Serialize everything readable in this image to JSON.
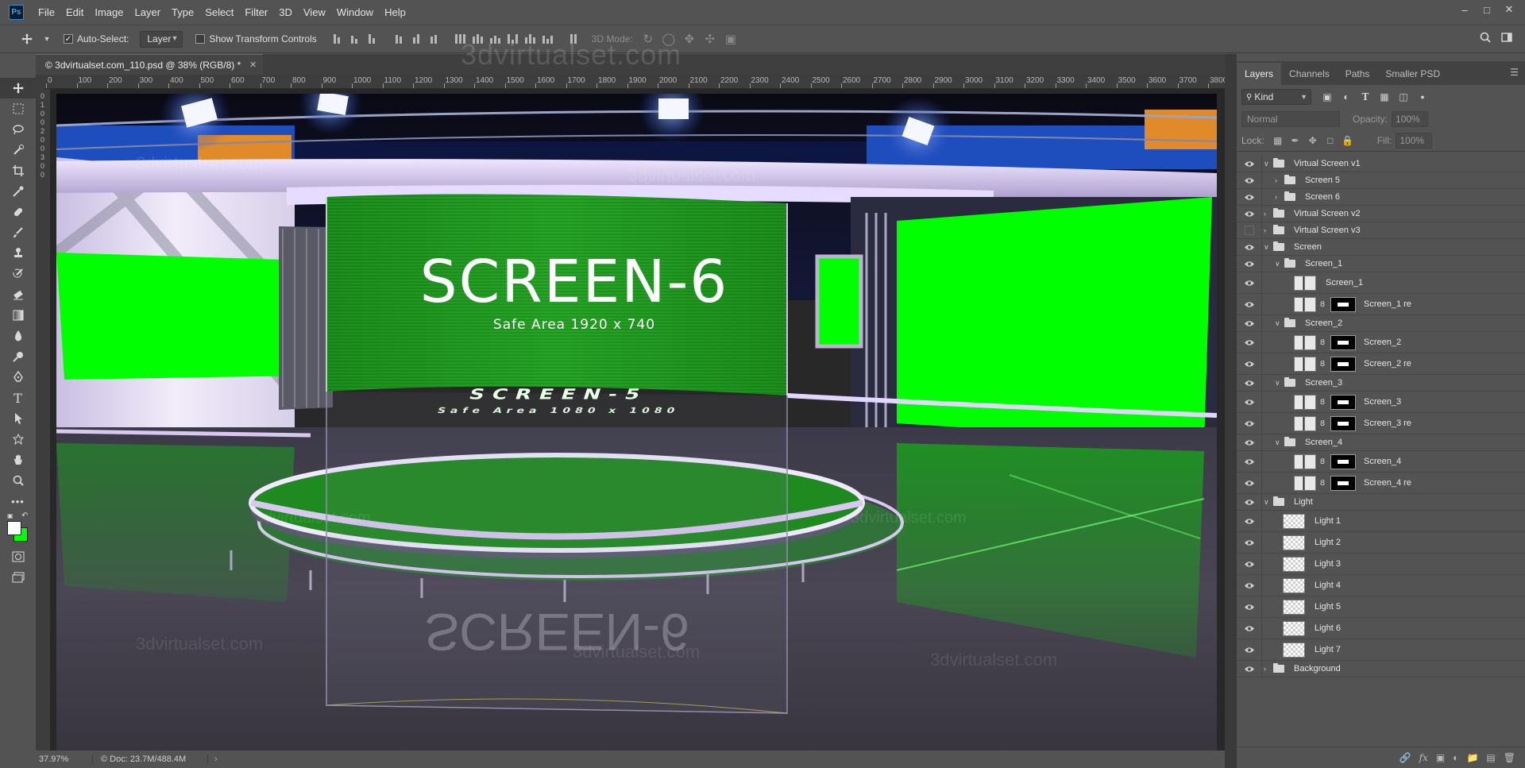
{
  "app": {
    "logo_text": "Ps",
    "menu": [
      "File",
      "Edit",
      "Image",
      "Layer",
      "Type",
      "Select",
      "Filter",
      "3D",
      "View",
      "Window",
      "Help"
    ],
    "window_controls": [
      "–",
      "□",
      "✕"
    ]
  },
  "options": {
    "auto_select_label": "Auto-Select:",
    "auto_select_checked": true,
    "auto_select_target": "Layer",
    "transform_controls_label": "Show Transform Controls",
    "mode_3d_label": "3D Mode:"
  },
  "document": {
    "tab_title": "© 3dvirtualset.com_110.psd @ 38% (RGB/8) *",
    "ruler_h": [
      "0",
      "100",
      "200",
      "300",
      "400",
      "500",
      "600",
      "700",
      "800",
      "900",
      "1000",
      "1100",
      "1200",
      "1300",
      "1400",
      "1500",
      "1600",
      "1700",
      "1800",
      "1900",
      "2000",
      "2100",
      "2200",
      "2300",
      "2400",
      "2500",
      "2600",
      "2700",
      "2800",
      "2900",
      "3000",
      "3100",
      "3200",
      "3300",
      "3400",
      "3500",
      "3600",
      "3700",
      "3800"
    ],
    "ruler_v": [
      "0",
      "1",
      "0",
      "0",
      "2",
      "0",
      "0",
      "3",
      "0",
      "0"
    ],
    "watermark": "3dvirtualset.com"
  },
  "scene": {
    "main_screen_title": "SCREEN-6",
    "main_screen_subtitle": "Safe Area 1920 x 740",
    "floor_title": "SCREEN-5",
    "floor_subtitle": "Safe Area 1080 x 1080",
    "colors": {
      "chroma": "#00ff00",
      "chroma_dark": "#1fb81f",
      "stage_light": "#d8c8f0"
    }
  },
  "status": {
    "zoom": "37.97%",
    "doc_size": "Doc: 23.7M/488.4M",
    "arrow": "›"
  },
  "panel": {
    "tabs": [
      "Layers",
      "Channels",
      "Paths",
      "Smaller PSD"
    ],
    "active_tab": "Layers",
    "filter_kind": "Kind",
    "blend_mode": "Normal",
    "opacity_label": "Opacity:",
    "opacity_value": "100%",
    "lock_label": "Lock:",
    "fill_label": "Fill:",
    "fill_value": "100%"
  },
  "layers": [
    {
      "name": "Virtual Screen v1",
      "type": "group",
      "indent": 0,
      "expanded": true,
      "visible": true
    },
    {
      "name": "Screen 5",
      "type": "group",
      "indent": 1,
      "expanded": false,
      "visible": true
    },
    {
      "name": "Screen 6",
      "type": "group",
      "indent": 1,
      "expanded": false,
      "visible": true
    },
    {
      "name": "Virtual Screen v2",
      "type": "group",
      "indent": 0,
      "expanded": false,
      "visible": true
    },
    {
      "name": "Virtual Screen v3",
      "type": "group",
      "indent": 0,
      "expanded": false,
      "visible": false
    },
    {
      "name": "Screen",
      "type": "group",
      "indent": 0,
      "expanded": true,
      "visible": true
    },
    {
      "name": "Screen_1",
      "type": "group",
      "indent": 1,
      "expanded": true,
      "visible": true
    },
    {
      "name": "Screen_1",
      "type": "smart",
      "indent": 2,
      "visible": true
    },
    {
      "name": "Screen_1 re",
      "type": "masked",
      "indent": 2,
      "visible": true
    },
    {
      "name": "Screen_2",
      "type": "group",
      "indent": 1,
      "expanded": true,
      "visible": true
    },
    {
      "name": "Screen_2",
      "type": "masked",
      "indent": 2,
      "visible": true
    },
    {
      "name": "Screen_2  re",
      "type": "masked",
      "indent": 2,
      "visible": true
    },
    {
      "name": "Screen_3",
      "type": "group",
      "indent": 1,
      "expanded": true,
      "visible": true
    },
    {
      "name": "Screen_3",
      "type": "masked",
      "indent": 2,
      "visible": true
    },
    {
      "name": "Screen_3  re",
      "type": "masked",
      "indent": 2,
      "visible": true
    },
    {
      "name": "Screen_4",
      "type": "group",
      "indent": 1,
      "expanded": true,
      "visible": true
    },
    {
      "name": "Screen_4",
      "type": "masked",
      "indent": 2,
      "visible": true
    },
    {
      "name": "Screen_4  re",
      "type": "masked",
      "indent": 2,
      "visible": true
    },
    {
      "name": "Light",
      "type": "group",
      "indent": 0,
      "expanded": true,
      "visible": true
    },
    {
      "name": "Light 1",
      "type": "pixel",
      "indent": 1,
      "visible": true
    },
    {
      "name": "Light 2",
      "type": "pixel",
      "indent": 1,
      "visible": true
    },
    {
      "name": "Light 3",
      "type": "pixel",
      "indent": 1,
      "visible": true
    },
    {
      "name": "Light 4",
      "type": "pixel",
      "indent": 1,
      "visible": true
    },
    {
      "name": "Light 5",
      "type": "pixel",
      "indent": 1,
      "visible": true
    },
    {
      "name": "Light 6",
      "type": "pixel",
      "indent": 1,
      "visible": true
    },
    {
      "name": "Light 7",
      "type": "pixel",
      "indent": 1,
      "visible": true
    },
    {
      "name": "Background",
      "type": "group",
      "indent": 0,
      "expanded": false,
      "visible": true
    }
  ]
}
